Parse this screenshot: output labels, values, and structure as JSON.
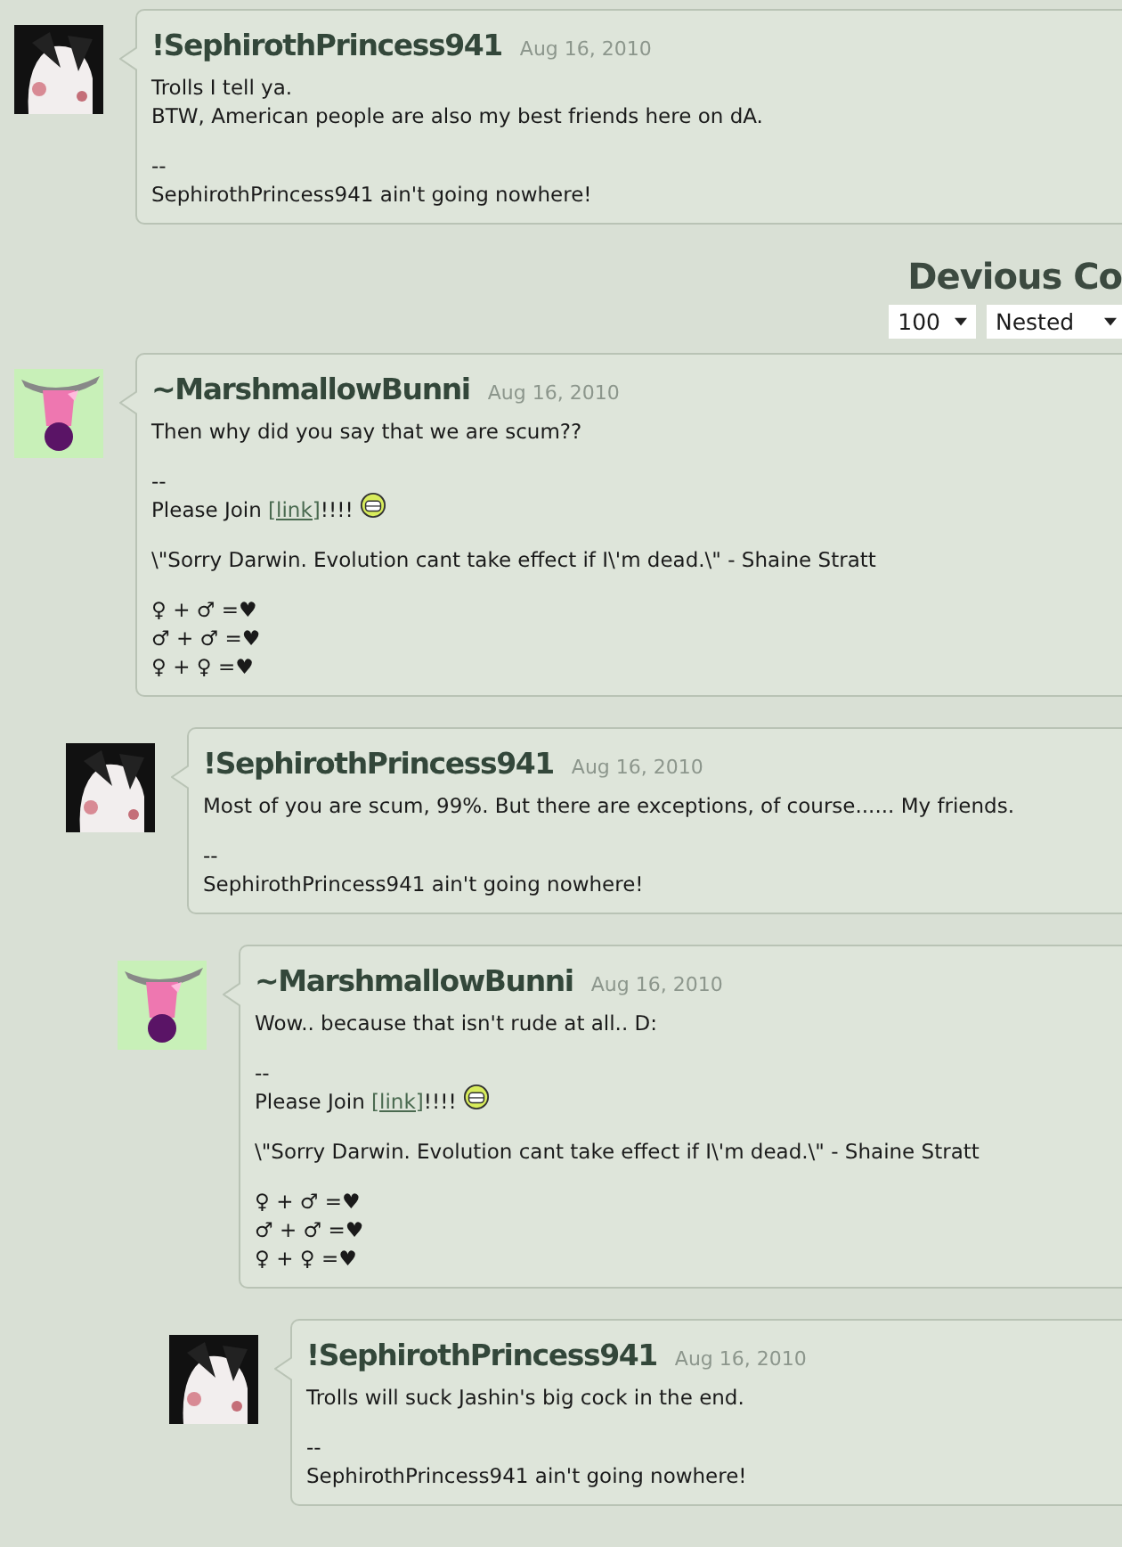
{
  "comments": [
    {
      "author": "!SephirothPrincess941",
      "date": "Aug 16, 2010",
      "paragraphs": [
        {
          "kind": "text",
          "lines": [
            "Trolls I tell ya.",
            "BTW, American people are also my best friends here on dA."
          ]
        },
        {
          "kind": "text",
          "lines": [
            "--",
            "SephirothPrincess941 ain't going nowhere!"
          ]
        }
      ]
    }
  ],
  "section": {
    "title": "Devious Co",
    "per_page": "100",
    "order": "Nested"
  },
  "thread": [
    {
      "author": "~MarshmallowBunni",
      "date": "Aug 16, 2010",
      "paragraphs": [
        {
          "kind": "text",
          "lines": [
            "Then why did you say that we are scum??"
          ]
        },
        {
          "kind": "join",
          "dash": "--",
          "before": "Please Join ",
          "link": "[link]",
          "after": "!!!!"
        },
        {
          "kind": "text",
          "lines": [
            "\\\"Sorry Darwin. Evolution cant take effect if I\\'m dead.\\\" - Shaine Stratt"
          ]
        },
        {
          "kind": "text",
          "lines": [
            "♀ + ♂ =♥",
            "♂ + ♂ =♥",
            "♀ + ♀ =♥"
          ]
        }
      ],
      "replies": [
        {
          "author": "!SephirothPrincess941",
          "date": "Aug 16, 2010",
          "paragraphs": [
            {
              "kind": "text",
              "lines": [
                "Most of you are scum, 99%. But there are exceptions, of course...... My friends."
              ]
            },
            {
              "kind": "text",
              "lines": [
                "--",
                "SephirothPrincess941 ain't going nowhere!"
              ]
            }
          ],
          "replies": [
            {
              "author": "~MarshmallowBunni",
              "date": "Aug 16, 2010",
              "paragraphs": [
                {
                  "kind": "text",
                  "lines": [
                    "Wow.. because that isn't rude at all.. D:"
                  ]
                },
                {
                  "kind": "join",
                  "dash": "--",
                  "before": "Please Join ",
                  "link": "[link]",
                  "after": "!!!!"
                },
                {
                  "kind": "text",
                  "lines": [
                    "\\\"Sorry Darwin. Evolution cant take effect if I\\'m dead.\\\" - Shaine Stratt"
                  ]
                },
                {
                  "kind": "text",
                  "lines": [
                    "♀ + ♂ =♥",
                    "♂ + ♂ =♥",
                    "♀ + ♀ =♥"
                  ]
                }
              ],
              "replies": [
                {
                  "author": "!SephirothPrincess941",
                  "date": "Aug 16, 2010",
                  "paragraphs": [
                    {
                      "kind": "text",
                      "lines": [
                        "Trolls will suck Jashin's big cock in the end."
                      ]
                    },
                    {
                      "kind": "text",
                      "lines": [
                        "--",
                        "SephirothPrincess941 ain't going nowhere!"
                      ]
                    }
                  ]
                }
              ]
            }
          ]
        }
      ]
    }
  ]
}
